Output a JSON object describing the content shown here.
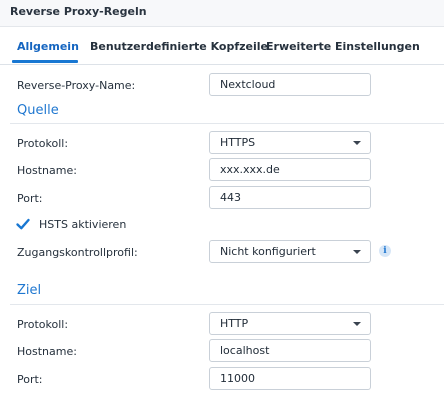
{
  "window": {
    "title": "Reverse Proxy-Regeln"
  },
  "tabs": [
    {
      "label": "Allgemein",
      "active": true
    },
    {
      "label": "Benutzerdefinierte Kopfzeile",
      "active": false
    },
    {
      "label": "Erweiterte Einstellungen",
      "active": false
    }
  ],
  "general": {
    "name_label": "Reverse-Proxy-Name:",
    "name_value": "Nextcloud"
  },
  "source": {
    "heading": "Quelle",
    "protocol_label": "Protokoll:",
    "protocol_value": "HTTPS",
    "hostname_label": "Hostname:",
    "hostname_value": "xxx.xxx.de",
    "port_label": "Port:",
    "port_value": "443",
    "hsts_label": "HSTS aktivieren",
    "hsts_checked": true,
    "access_label": "Zugangskontrollprofil:",
    "access_value": "Nicht konfiguriert",
    "info_icon": "info-icon"
  },
  "destination": {
    "heading": "Ziel",
    "protocol_label": "Protokoll:",
    "protocol_value": "HTTP",
    "hostname_label": "Hostname:",
    "hostname_value": "localhost",
    "port_label": "Port:",
    "port_value": "11000"
  },
  "colors": {
    "accent": "#1877d2",
    "heading": "#1f77d0"
  }
}
